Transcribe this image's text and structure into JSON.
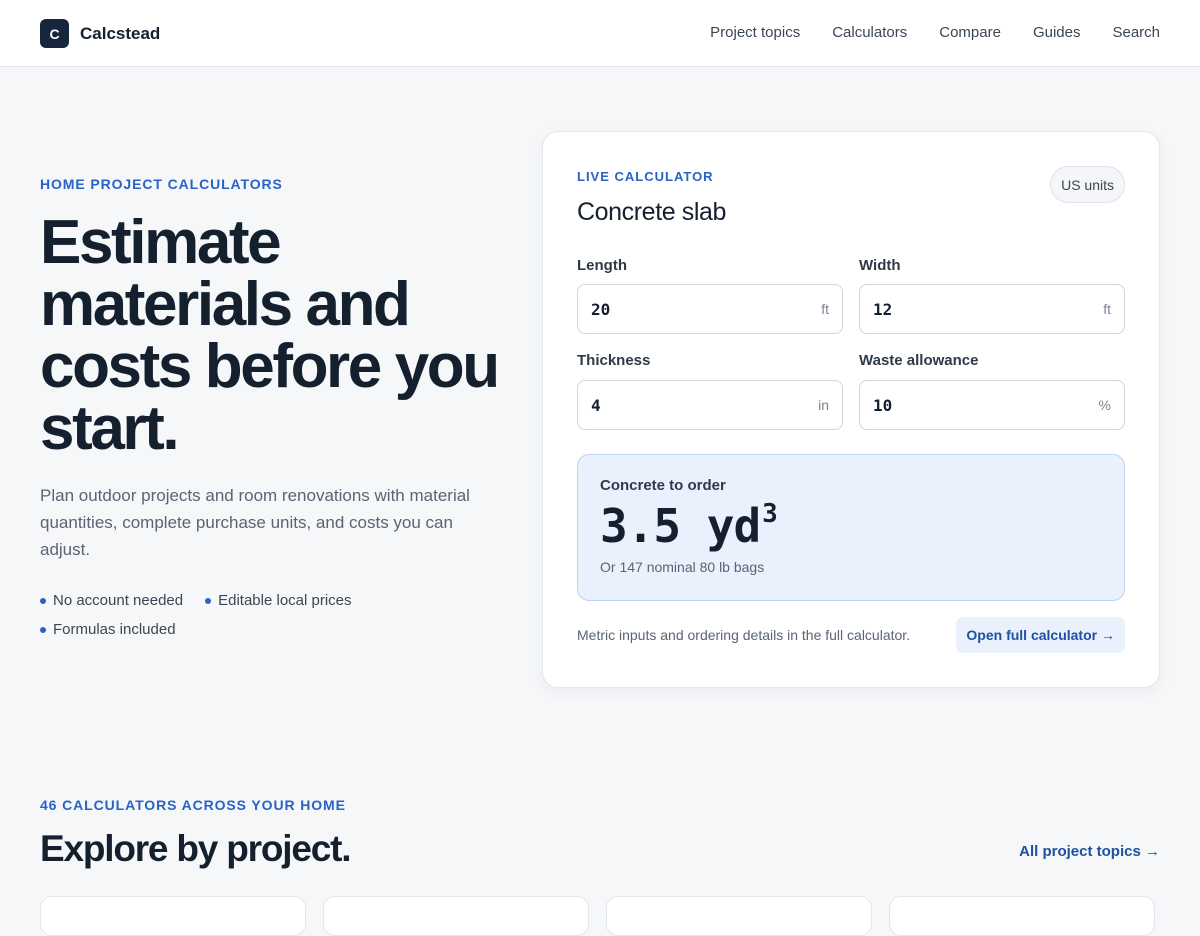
{
  "header": {
    "brand_mark": "C",
    "brand_name": "Calcstead",
    "nav": [
      "Project topics",
      "Calculators",
      "Compare",
      "Guides",
      "Search"
    ]
  },
  "hero": {
    "eyebrow": "HOME PROJECT CALCULATORS",
    "title": "Estimate materials and costs before you start.",
    "description": "Plan outdoor projects and room renovations with material quantities, complete purchase units, and costs you can adjust.",
    "features": [
      "No account needed",
      "Editable local prices",
      "Formulas included"
    ]
  },
  "calculator": {
    "eyebrow": "LIVE CALCULATOR",
    "title": "Concrete slab",
    "units_label": "US units",
    "fields": [
      {
        "label": "Length",
        "value": "20",
        "unit": "ft"
      },
      {
        "label": "Width",
        "value": "12",
        "unit": "ft"
      },
      {
        "label": "Thickness",
        "value": "4",
        "unit": "in"
      },
      {
        "label": "Waste allowance",
        "value": "10",
        "unit": "%"
      }
    ],
    "result": {
      "label": "Concrete to order",
      "value": "3.5 yd",
      "exponent": "3",
      "sub": "Or 147 nominal 80 lb bags"
    },
    "note": "Metric inputs and ordering details in the full calculator.",
    "open_label": "Open full calculator →"
  },
  "explore": {
    "eyebrow": "46 CALCULATORS ACROSS YOUR HOME",
    "title": "Explore by project.",
    "all_topics_label": "All project topics →"
  },
  "colors": {
    "accent": "#2763c7",
    "brand_dark": "#16263d",
    "result_bg": "#eaf1fd"
  }
}
